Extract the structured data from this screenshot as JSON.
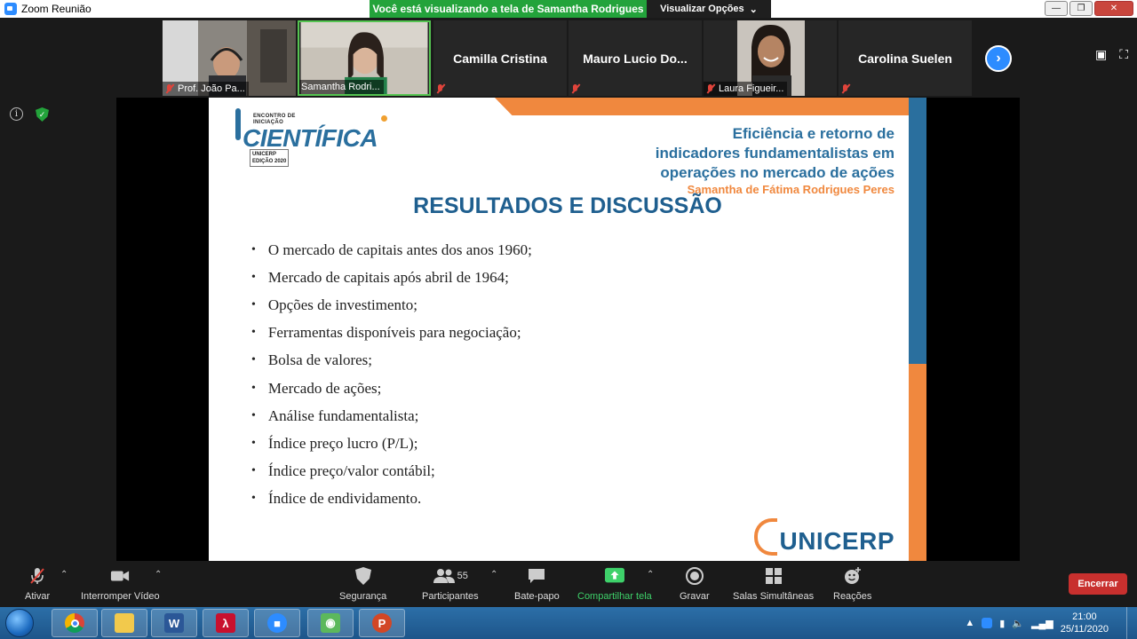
{
  "window": {
    "app_title": "Zoom Reunião",
    "share_banner": "Você está visualizando a tela de Samantha Rodrigues",
    "view_options": "Visualizar Opções"
  },
  "participants": [
    {
      "name": "Prof. João Pa...",
      "muted": true,
      "video": true
    },
    {
      "name": "Samantha Rodri...",
      "muted": false,
      "video": true,
      "active": true
    },
    {
      "name": "Camilla Cristina",
      "muted": true,
      "video": false
    },
    {
      "name": "Mauro Lucio Do...",
      "muted": true,
      "video": false
    },
    {
      "name": "Laura Figueir...",
      "muted": true,
      "video": true
    },
    {
      "name": "Carolina Suelen",
      "muted": true,
      "video": false
    }
  ],
  "slide": {
    "logo_small_1": "ENCONTRO DE",
    "logo_small_2": "INICIAÇÃO",
    "logo_big": "CIENTÍFICA",
    "logo_edition_1": "UNICERP",
    "logo_edition_2": "EDIÇÃO 2020",
    "title_line_1": "Eficiência e retorno de",
    "title_line_2": "indicadores fundamentalistas em",
    "title_line_3": "operações no mercado de ações",
    "author": "Samantha de Fátima Rodrigues Peres",
    "section_heading": "RESULTADOS E DISCUSSÃO",
    "bullets": [
      "O mercado de capitais antes dos anos 1960;",
      "Mercado de capitais após abril de 1964;",
      "Opções de investimento;",
      "Ferramentas disponíveis para negociação;",
      "Bolsa de valores;",
      "Mercado de ações;",
      "Análise fundamentalista;",
      "Índice preço lucro (P/L);",
      "Índice preço/valor contábil;",
      "Índice de endividamento."
    ],
    "footer_logo": "UNICERP"
  },
  "toolbar": {
    "mute_label": "Ativar",
    "video_label": "Interromper Vídeo",
    "security_label": "Segurança",
    "participants_label": "Participantes",
    "participants_count": "55",
    "chat_label": "Bate-papo",
    "share_label": "Compartilhar tela",
    "record_label": "Gravar",
    "breakout_label": "Salas Simultâneas",
    "reactions_label": "Reações",
    "end_label": "Encerrar"
  },
  "taskbar": {
    "time": "21:00",
    "date": "25/11/2020",
    "apps": [
      "chrome",
      "file-explorer",
      "word",
      "acrobat",
      "zoom",
      "android",
      "powerpoint"
    ]
  },
  "colors": {
    "share_green": "#23a33b",
    "slide_blue": "#2a6f9e",
    "slide_orange": "#f0883e",
    "end_red": "#c8302e",
    "zoom_blue": "#2d8cff"
  }
}
